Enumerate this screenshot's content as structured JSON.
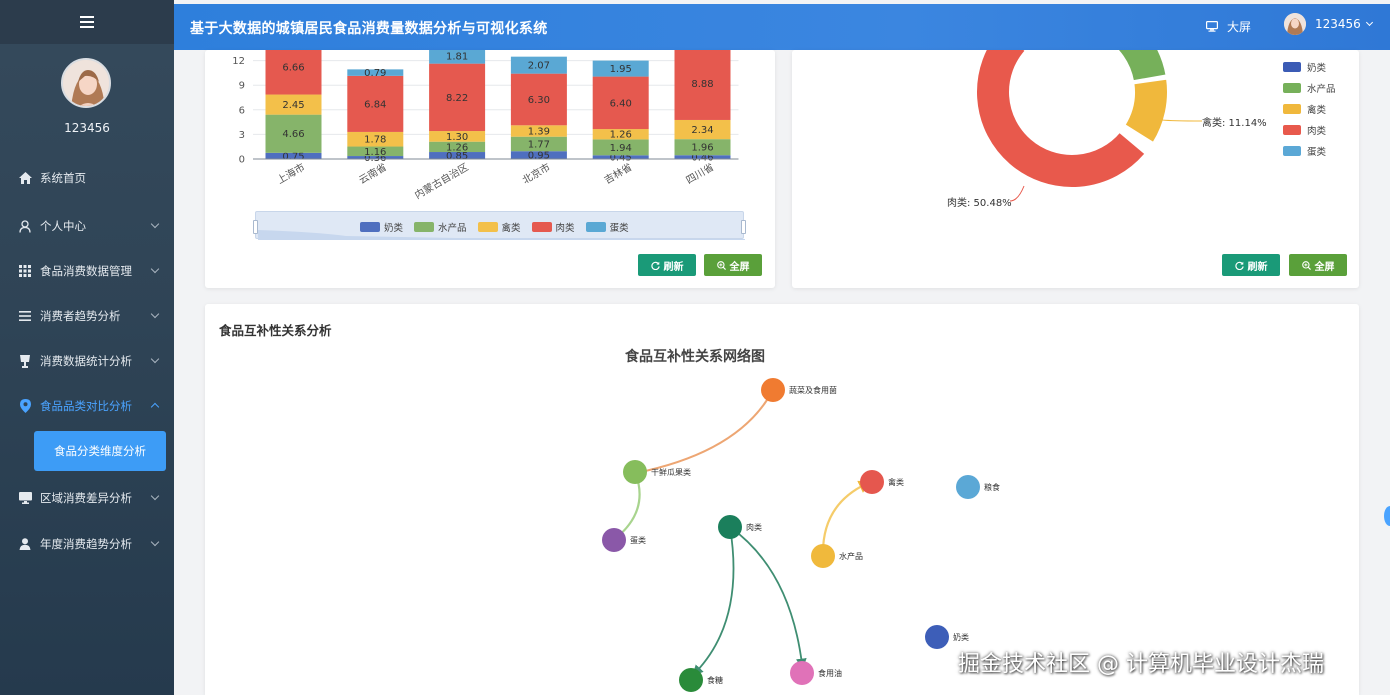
{
  "sidebar": {
    "username": "123456",
    "items": [
      {
        "label": "系统首页",
        "icon": "home-icon"
      },
      {
        "label": "个人中心",
        "icon": "user-icon"
      },
      {
        "label": "食品消费数据管理",
        "icon": "grid-icon"
      },
      {
        "label": "消费者趋势分析",
        "icon": "list-icon"
      },
      {
        "label": "消费数据统计分析",
        "icon": "cup-icon"
      },
      {
        "label": "食品品类对比分析",
        "icon": "location-icon"
      },
      {
        "label": "区域消费差异分析",
        "icon": "monitor-icon"
      },
      {
        "label": "年度消费趋势分析",
        "icon": "person-icon"
      }
    ],
    "submenu_active": "食品分类维度分析"
  },
  "header": {
    "title": "基于大数据的城镇居民食品消费量数据分析与可视化系统",
    "screen_label": "大屏",
    "user_label": "123456"
  },
  "buttons": {
    "refresh": "刷新",
    "fullscreen": "全屏"
  },
  "chart_data": [
    {
      "type": "bar",
      "stacked": true,
      "categories": [
        "上海市",
        "云南省",
        "内蒙古自治区",
        "北京市",
        "吉林省",
        "四川省"
      ],
      "yticks": [
        0,
        3,
        6,
        9,
        12
      ],
      "series": [
        {
          "name": "奶类",
          "color": "#4f6fbf",
          "values": [
            0.75,
            0.36,
            0.85,
            0.95,
            0.45,
            0.46
          ]
        },
        {
          "name": "水产品",
          "color": "#86b46a",
          "values": [
            4.66,
            1.16,
            1.26,
            1.77,
            1.94,
            1.96
          ]
        },
        {
          "name": "禽类",
          "color": "#f3c04a",
          "values": [
            2.45,
            1.78,
            1.3,
            1.39,
            1.26,
            2.34
          ]
        },
        {
          "name": "肉类",
          "color": "#e5594f",
          "values": [
            6.66,
            6.84,
            8.22,
            6.3,
            6.4,
            8.88
          ]
        },
        {
          "name": "蛋类",
          "color": "#5aa8d4",
          "values": [
            null,
            0.79,
            1.81,
            2.07,
            1.95,
            null
          ]
        }
      ],
      "legend_position": "bottom (inside data zoom slider)"
    },
    {
      "type": "pie",
      "donut": true,
      "visible_labels": [
        {
          "name": "禽类",
          "text": "禽类: 11.14%"
        },
        {
          "name": "肉类",
          "text": "肉类: 50.48%"
        }
      ],
      "slices": [
        {
          "name": "奶类",
          "color": "#3b5bb5"
        },
        {
          "name": "水产品",
          "color": "#76b05a"
        },
        {
          "name": "禽类",
          "color": "#f0b83c",
          "percent": 11.14
        },
        {
          "name": "肉类",
          "color": "#e8594c",
          "percent": 50.48
        },
        {
          "name": "蛋类",
          "color": "#5ba8d6"
        }
      ],
      "legend_position": "right"
    }
  ],
  "network": {
    "section_title": "食品互补性关系分析",
    "title": "食品互补性关系网络图",
    "nodes": [
      {
        "label": "蔬菜及食用菌",
        "color": "#f07b31"
      },
      {
        "label": "干鲜瓜果类",
        "color": "#86bd5c"
      },
      {
        "label": "蛋类",
        "color": "#8a58a8"
      },
      {
        "label": "肉类",
        "color": "#1b7f5c"
      },
      {
        "label": "禽类",
        "color": "#e5574e"
      },
      {
        "label": "粮食",
        "color": "#5ba8d6"
      },
      {
        "label": "水产品",
        "color": "#f0b93c"
      },
      {
        "label": "奶类",
        "color": "#3d5eb8"
      },
      {
        "label": "食糖",
        "color": "#2a8b3a"
      },
      {
        "label": "食用油",
        "color": "#e072b8"
      }
    ]
  },
  "watermark": "掘金技术社区 @ 计算机毕业设计杰瑞"
}
